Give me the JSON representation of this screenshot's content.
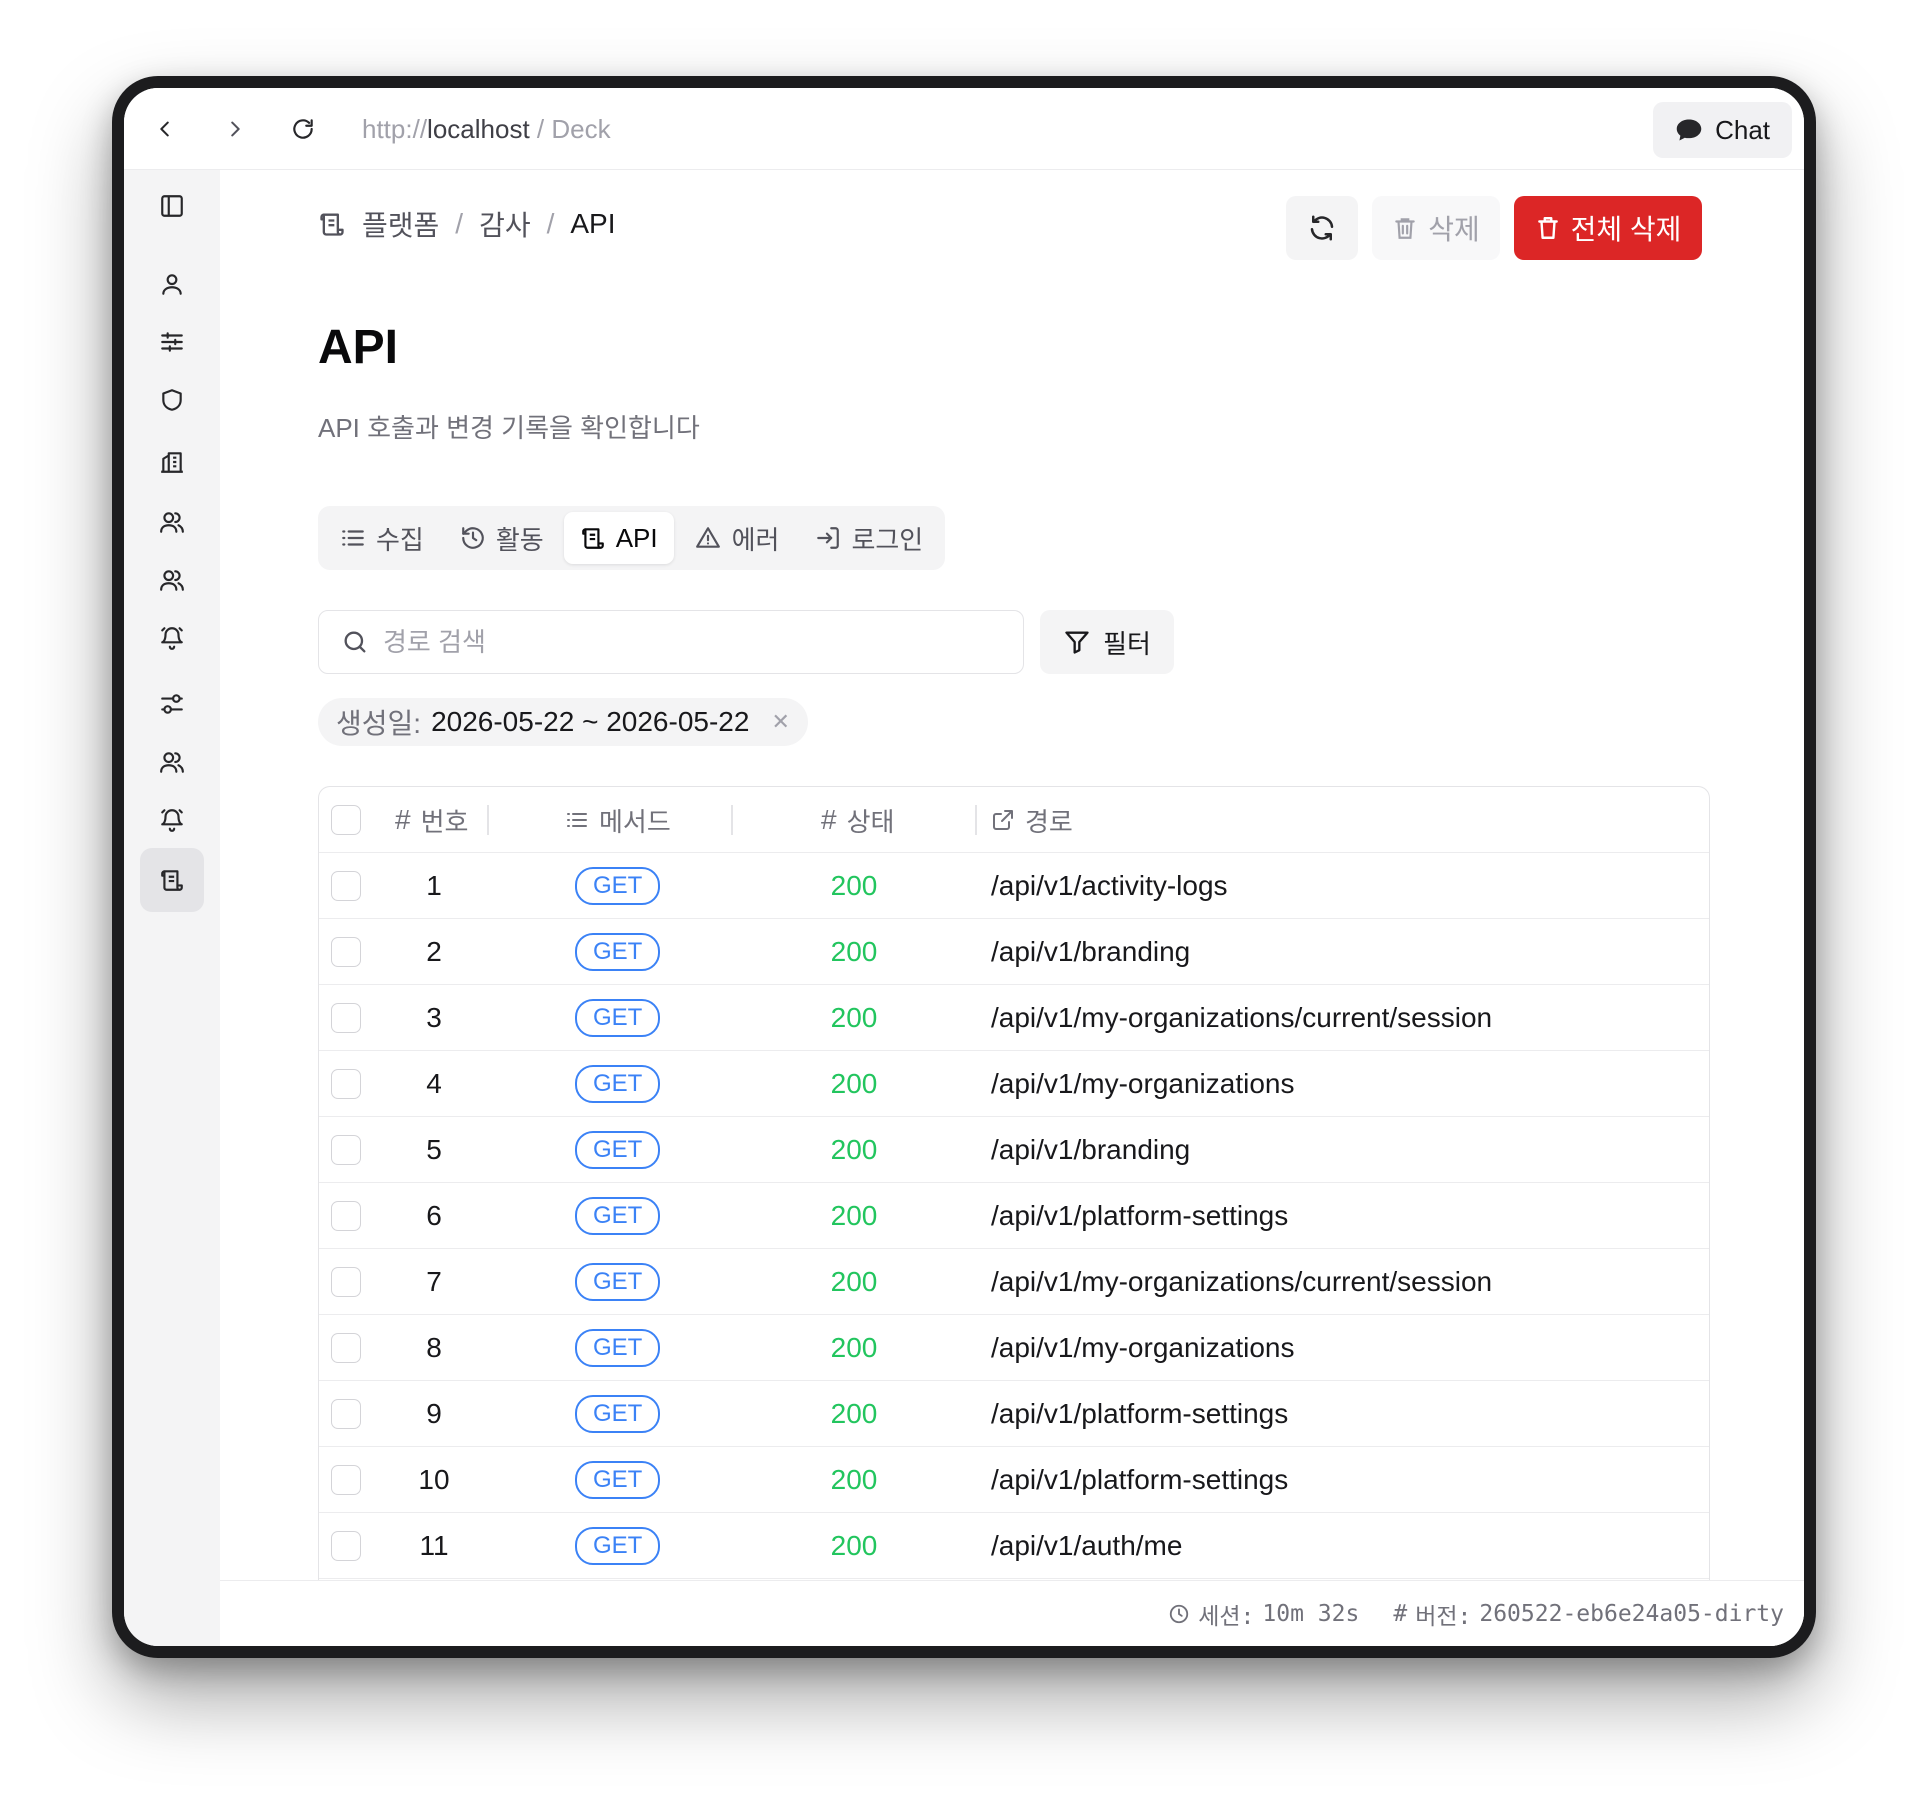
{
  "browser": {
    "url_scheme": "http://",
    "url_host": "localhost",
    "url_sep": " / ",
    "url_path": "Deck",
    "chat_label": "Chat"
  },
  "breadcrumb": {
    "items": [
      "플랫폼",
      "감사",
      "API"
    ],
    "separator": "/"
  },
  "toolbar": {
    "delete_label": "삭제",
    "delete_all_label": "전체 삭제"
  },
  "page": {
    "title": "API",
    "description": "API 호출과 변경 기록을 확인합니다"
  },
  "tabs": [
    {
      "label": "수집",
      "icon": "list-icon",
      "active": false
    },
    {
      "label": "활동",
      "icon": "history-icon",
      "active": false
    },
    {
      "label": "API",
      "icon": "scroll-icon",
      "active": true
    },
    {
      "label": "에러",
      "icon": "warning-icon",
      "active": false
    },
    {
      "label": "로그인",
      "icon": "login-icon",
      "active": false
    }
  ],
  "search": {
    "placeholder": "경로 검색",
    "value": ""
  },
  "filter": {
    "label": "필터",
    "chip_label": "생성일:",
    "chip_value": "2026-05-22 ~ 2026-05-22"
  },
  "table": {
    "columns": {
      "number": "번호",
      "method": "메서드",
      "status": "상태",
      "path": "경로"
    },
    "rows": [
      {
        "number": "1",
        "method": "GET",
        "status": "200",
        "path": "/api/v1/activity-logs"
      },
      {
        "number": "2",
        "method": "GET",
        "status": "200",
        "path": "/api/v1/branding"
      },
      {
        "number": "3",
        "method": "GET",
        "status": "200",
        "path": "/api/v1/my-organizations/current/session"
      },
      {
        "number": "4",
        "method": "GET",
        "status": "200",
        "path": "/api/v1/my-organizations"
      },
      {
        "number": "5",
        "method": "GET",
        "status": "200",
        "path": "/api/v1/branding"
      },
      {
        "number": "6",
        "method": "GET",
        "status": "200",
        "path": "/api/v1/platform-settings"
      },
      {
        "number": "7",
        "method": "GET",
        "status": "200",
        "path": "/api/v1/my-organizations/current/session"
      },
      {
        "number": "8",
        "method": "GET",
        "status": "200",
        "path": "/api/v1/my-organizations"
      },
      {
        "number": "9",
        "method": "GET",
        "status": "200",
        "path": "/api/v1/platform-settings"
      },
      {
        "number": "10",
        "method": "GET",
        "status": "200",
        "path": "/api/v1/platform-settings"
      },
      {
        "number": "11",
        "method": "GET",
        "status": "200",
        "path": "/api/v1/auth/me"
      }
    ]
  },
  "footer": {
    "session_label": "세션:",
    "session_value": "10m 32s",
    "version_label": "버전:",
    "version_value": "260522-eb6e24a05-dirty"
  },
  "colors": {
    "accent_danger": "#dc2626",
    "method_get": "#3b82f6",
    "status_ok": "#22c55e"
  }
}
